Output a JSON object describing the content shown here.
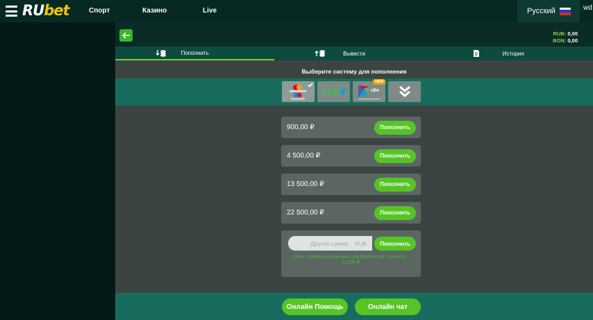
{
  "header": {
    "logo_ru": "RU",
    "logo_bet": "bet",
    "nav": [
      "Спорт",
      "Казино",
      "Live"
    ],
    "language": "Русский",
    "user_short": "wd"
  },
  "balance": {
    "rub_label": "RUB:",
    "rub_value": "0,00",
    "bon_label": "BON:",
    "bon_value": "0,00"
  },
  "tabs": [
    {
      "label": "Пополнить",
      "icon": "deposit-coins-icon",
      "active": true
    },
    {
      "label": "Вывести",
      "icon": "withdraw-coins-icon",
      "active": false
    },
    {
      "label": "История",
      "icon": "document-icon",
      "active": false
    }
  ],
  "payment": {
    "title": "Выберите систему для пополнения",
    "methods": [
      {
        "name": "mastercard-maestro",
        "selected": true
      },
      {
        "name": "mir",
        "label": "МИР"
      },
      {
        "name": "sbp",
        "badge": "NEW"
      },
      {
        "name": "expand",
        "icon": "double-chevron-down-icon"
      }
    ]
  },
  "amounts": [
    {
      "value": "900,00 ₽",
      "button": "Пополнить"
    },
    {
      "value": "4 500,00 ₽",
      "button": "Пополнить"
    },
    {
      "value": "13 500,00 ₽",
      "button": "Пополнить"
    },
    {
      "value": "22 500,00 ₽",
      "button": "Пополнить"
    }
  ],
  "custom": {
    "placeholder": "Другая сумма",
    "currency": "RUB",
    "button": "Пополнить",
    "hint": "Мин. сумма пополнения для Mastercard / Maestro: 51100 ₽"
  },
  "footer": {
    "help_label": "Онлайн Помощь",
    "chat_label": "Онлайн чат"
  },
  "colors": {
    "accent_green": "#57c425",
    "brand_yellow": "#f2c500",
    "strip_teal": "#186c5e"
  }
}
